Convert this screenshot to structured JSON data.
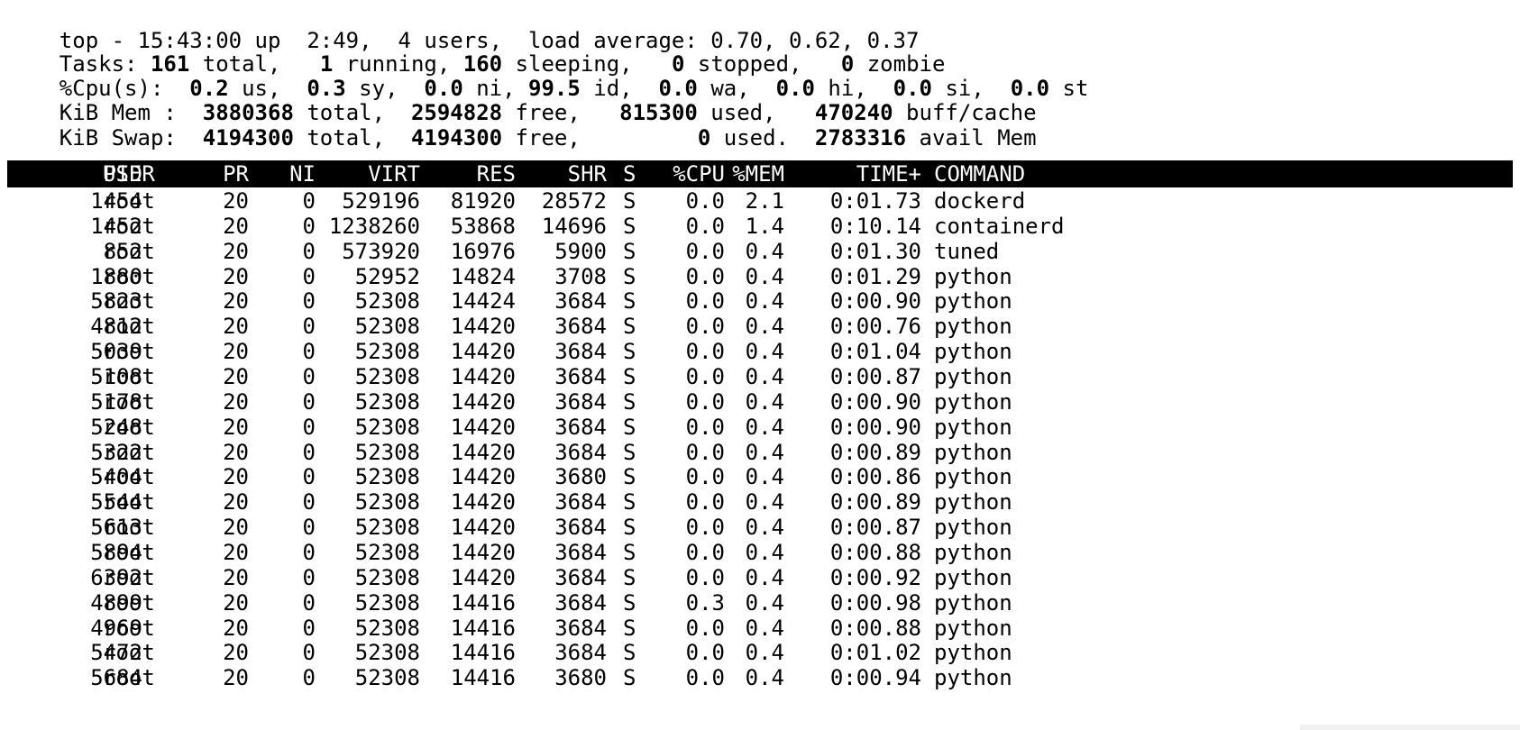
{
  "summary": {
    "line1": "top - 15:43:00 up  2:49,  4 users,  load average: 0.70, 0.62, 0.37",
    "tasks": {
      "label": "Tasks: ",
      "total": "161",
      "total_label": " total,   ",
      "running": "1",
      "running_label": " running, ",
      "sleeping": "160",
      "sleeping_label": " sleeping,   ",
      "stopped": "0",
      "stopped_label": " stopped,   ",
      "zombie": "0",
      "zombie_label": " zombie"
    },
    "cpu": {
      "label": "%Cpu(s):  ",
      "us": "0.2",
      "us_label": " us,  ",
      "sy": "0.3",
      "sy_label": " sy,  ",
      "ni": "0.0",
      "ni_label": " ni, ",
      "id": "99.5",
      "id_label": " id,  ",
      "wa": "0.0",
      "wa_label": " wa,  ",
      "hi": "0.0",
      "hi_label": " hi,  ",
      "si": "0.0",
      "si_label": " si,  ",
      "st": "0.0",
      "st_label": " st"
    },
    "mem": {
      "label": "KiB Mem :  ",
      "total": "3880368",
      "total_label": " total,  ",
      "free": "2594828",
      "free_label": " free,   ",
      "used": "815300",
      "used_label": " used,   ",
      "buff": "470240",
      "buff_label": " buff/cache"
    },
    "swap": {
      "label": "KiB Swap:  ",
      "total": "4194300",
      "total_label": " total,  ",
      "free": "4194300",
      "free_label": " free,         ",
      "used": "0",
      "used_label": " used.  ",
      "avail": "2783316",
      "avail_label": " avail Mem"
    }
  },
  "process_table": {
    "columns": [
      "PID",
      "USER",
      "PR",
      "NI",
      "VIRT",
      "RES",
      "SHR",
      "S",
      "%CPU",
      "%MEM",
      "TIME+",
      "COMMAND"
    ],
    "rows": [
      [
        "1454",
        "root",
        "20",
        "0",
        "529196",
        "81920",
        "28572",
        "S",
        "0.0",
        "2.1",
        "0:01.73",
        "dockerd"
      ],
      [
        "1452",
        "root",
        "20",
        "0",
        "1238260",
        "53868",
        "14696",
        "S",
        "0.0",
        "1.4",
        "0:10.14",
        "containerd"
      ],
      [
        "852",
        "root",
        "20",
        "0",
        "573920",
        "16976",
        "5900",
        "S",
        "0.0",
        "0.4",
        "0:01.30",
        "tuned"
      ],
      [
        "1880",
        "root",
        "20",
        "0",
        "52952",
        "14824",
        "3708",
        "S",
        "0.0",
        "0.4",
        "0:01.29",
        "python"
      ],
      [
        "5823",
        "root",
        "20",
        "0",
        "52308",
        "14424",
        "3684",
        "S",
        "0.0",
        "0.4",
        "0:00.90",
        "python"
      ],
      [
        "4812",
        "root",
        "20",
        "0",
        "52308",
        "14420",
        "3684",
        "S",
        "0.0",
        "0.4",
        "0:00.76",
        "python"
      ],
      [
        "5039",
        "root",
        "20",
        "0",
        "52308",
        "14420",
        "3684",
        "S",
        "0.0",
        "0.4",
        "0:01.04",
        "python"
      ],
      [
        "5108",
        "root",
        "20",
        "0",
        "52308",
        "14420",
        "3684",
        "S",
        "0.0",
        "0.4",
        "0:00.87",
        "python"
      ],
      [
        "5178",
        "root",
        "20",
        "0",
        "52308",
        "14420",
        "3684",
        "S",
        "0.0",
        "0.4",
        "0:00.90",
        "python"
      ],
      [
        "5248",
        "root",
        "20",
        "0",
        "52308",
        "14420",
        "3684",
        "S",
        "0.0",
        "0.4",
        "0:00.90",
        "python"
      ],
      [
        "5322",
        "root",
        "20",
        "0",
        "52308",
        "14420",
        "3684",
        "S",
        "0.0",
        "0.4",
        "0:00.89",
        "python"
      ],
      [
        "5404",
        "root",
        "20",
        "0",
        "52308",
        "14420",
        "3680",
        "S",
        "0.0",
        "0.4",
        "0:00.86",
        "python"
      ],
      [
        "5544",
        "root",
        "20",
        "0",
        "52308",
        "14420",
        "3684",
        "S",
        "0.0",
        "0.4",
        "0:00.89",
        "python"
      ],
      [
        "5613",
        "root",
        "20",
        "0",
        "52308",
        "14420",
        "3684",
        "S",
        "0.0",
        "0.4",
        "0:00.87",
        "python"
      ],
      [
        "5894",
        "root",
        "20",
        "0",
        "52308",
        "14420",
        "3684",
        "S",
        "0.0",
        "0.4",
        "0:00.88",
        "python"
      ],
      [
        "6392",
        "root",
        "20",
        "0",
        "52308",
        "14420",
        "3684",
        "S",
        "0.0",
        "0.4",
        "0:00.92",
        "python"
      ],
      [
        "4899",
        "root",
        "20",
        "0",
        "52308",
        "14416",
        "3684",
        "S",
        "0.3",
        "0.4",
        "0:00.98",
        "python"
      ],
      [
        "4969",
        "root",
        "20",
        "0",
        "52308",
        "14416",
        "3684",
        "S",
        "0.0",
        "0.4",
        "0:00.88",
        "python"
      ],
      [
        "5472",
        "root",
        "20",
        "0",
        "52308",
        "14416",
        "3684",
        "S",
        "0.0",
        "0.4",
        "0:01.02",
        "python"
      ],
      [
        "5684",
        "root",
        "20",
        "0",
        "52308",
        "14416",
        "3680",
        "S",
        "0.0",
        "0.4",
        "0:00.94",
        "python"
      ]
    ]
  }
}
